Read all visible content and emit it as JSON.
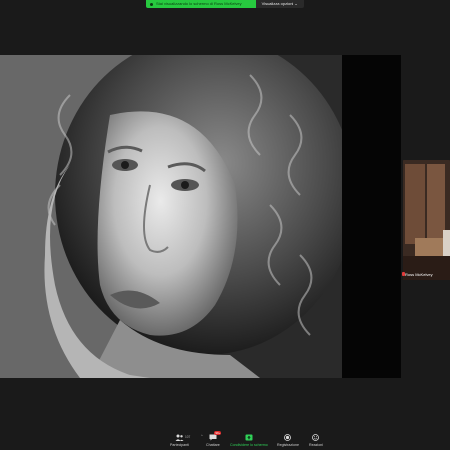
{
  "banner": {
    "sharing_text": "Stai visualizzando lo schermo di Ross McKelvey",
    "view_options": "Visualizza opzioni ⌄"
  },
  "participant": {
    "name": "Ross McKelvey"
  },
  "toolbar": {
    "participants": {
      "label": "Partecipanti",
      "count": "107",
      "icon": "people-icon"
    },
    "chat": {
      "label": "Chattare",
      "badge": "99+",
      "icon": "chat-icon"
    },
    "share": {
      "label": "Condividere lo schermo",
      "icon": "share-screen-icon"
    },
    "record": {
      "label": "Registrazione",
      "icon": "record-icon"
    },
    "reactions": {
      "label": "Reazioni",
      "icon": "emoji-icon"
    }
  },
  "colors": {
    "banner_green": "#27c93f",
    "share_green": "#30d158",
    "badge_red": "#e02a2a",
    "background": "#1a1a1a"
  }
}
